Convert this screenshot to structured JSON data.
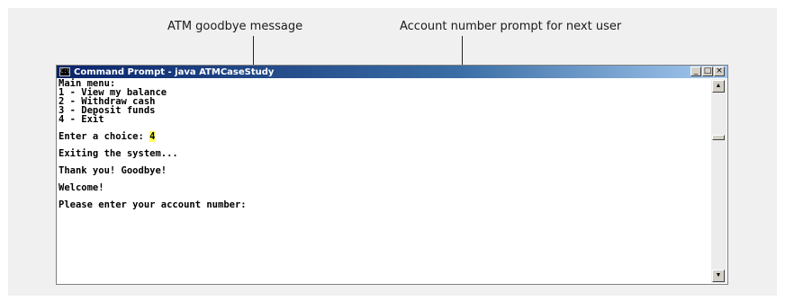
{
  "callouts": {
    "goodbye": "ATM goodbye message",
    "account_prompt": "Account number prompt for next user"
  },
  "window": {
    "title": "Command Prompt - java ATMCaseStudy",
    "icon_glyph": "C:\\",
    "buttons": {
      "minimize": "_",
      "maximize": "□",
      "close": "×"
    }
  },
  "console": {
    "main_menu": "Main menu:",
    "option1": "1 - View my balance",
    "option2": "2 - Withdraw cash",
    "option3": "3 - Deposit funds",
    "option4": "4 - Exit",
    "choice_prompt": "Enter a choice: ",
    "choice_value": "4",
    "exiting": "Exiting the system...",
    "goodbye": "Thank you! Goodbye!",
    "welcome": "Welcome!",
    "account_prompt": "Please enter your account number:"
  },
  "scrollbar": {
    "up": "▲",
    "down": "▼"
  }
}
